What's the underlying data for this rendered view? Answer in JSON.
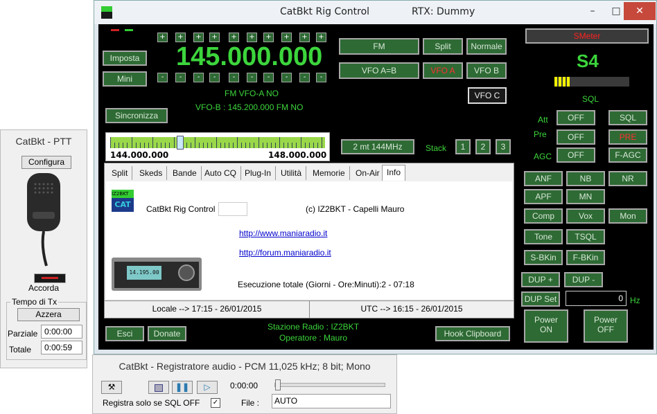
{
  "main": {
    "title": "CatBkt Rig Control",
    "rtx": "RTX: Dummy",
    "frequency": "145.000.000",
    "mode_line": "FM VFO-A NO",
    "vfob_line": "VFO-B : 145.200.000  FM NO",
    "buttons": {
      "imposta": "Imposta",
      "mini": "Mini",
      "sincronizza": "Sincronizza",
      "fm": "FM",
      "split": "Split",
      "normale": "Normale",
      "vfo_ab": "VFO A=B",
      "vfo_a": "VFO A",
      "vfo_b": "VFO B",
      "vfo_c": "VFO C",
      "band": "2 mt 144MHz",
      "stack_label": "Stack",
      "stack": [
        "1",
        "2",
        "3"
      ],
      "esci": "Esci",
      "donate": "Donate",
      "hook": "Hook Clipboard"
    },
    "plus": "+",
    "minus": "-",
    "band_range": {
      "low": "144.000.000",
      "high": "148.000.000",
      "position": 0.32
    },
    "tabs": [
      "Split",
      "Skeds",
      "Bande",
      "Auto CQ",
      "Plug-In",
      "Utilità",
      "Memorie",
      "On-Air",
      "Info"
    ],
    "info": {
      "logo_top": "IZ2BKT",
      "logo_bottom": "CAT",
      "app_name": "CatBkt Rig Control",
      "copyright": "(c) IZ2BKT - Capelli Mauro",
      "link1": "http://www.maniaradio.it",
      "link2": "http://forum.maniaradio.it",
      "runtime": "Esecuzione totale (Giorni - Ore:Minuti):2 - 07:18",
      "radio_display": "14.195.00"
    },
    "status": {
      "local": "Locale --> 17:15  -  26/01/2015",
      "utc": "UTC --> 16:15  -  26/01/2015",
      "station": "Stazione Radio : IZ2BKT",
      "operator": "Operatore : Mauro"
    },
    "right": {
      "smeter": "SMeter",
      "s_value": "S4",
      "s_level": 0.2,
      "sql_label": "SQL",
      "att_label": "Att",
      "pre_label": "Pre",
      "agc_label": "AGC",
      "off": "OFF",
      "sql": "SQL",
      "pre": "PRE",
      "fagc": "F-AGC",
      "anf": "ANF",
      "nb": "NB",
      "nr": "NR",
      "apf": "APF",
      "mn": "MN",
      "comp": "Comp",
      "vox": "Vox",
      "mon": "Mon",
      "tone": "Tone",
      "tsql": "TSQL",
      "sbkin": "S-BKin",
      "fbkin": "F-BKin",
      "dup_plus": "DUP +",
      "dup_minus": "DUP -",
      "dup_set": "DUP Set",
      "dup_value": "0",
      "hz": "Hz",
      "power_on": [
        "Power",
        "ON"
      ],
      "power_off": [
        "Power",
        "OFF"
      ]
    }
  },
  "ptt": {
    "title": "CatBkt - PTT",
    "configura": "Configura",
    "accorda": "Accorda",
    "group": "Tempo di Tx",
    "azzera": "Azzera",
    "parziale_label": "Parziale",
    "parziale": "0:00:00",
    "totale_label": "Totale",
    "totale": "0:00:59"
  },
  "rec": {
    "title": "CatBkt - Registratore audio - PCM 11,025 kHz; 8 bit; Mono",
    "time": "0:00:00",
    "sql_only": "Registra solo se SQL OFF",
    "file_label": "File :",
    "file": "AUTO"
  },
  "colors": {
    "green_text": "#3cd53c",
    "btn_green": "#2e6a34",
    "red": "#ff2020"
  }
}
